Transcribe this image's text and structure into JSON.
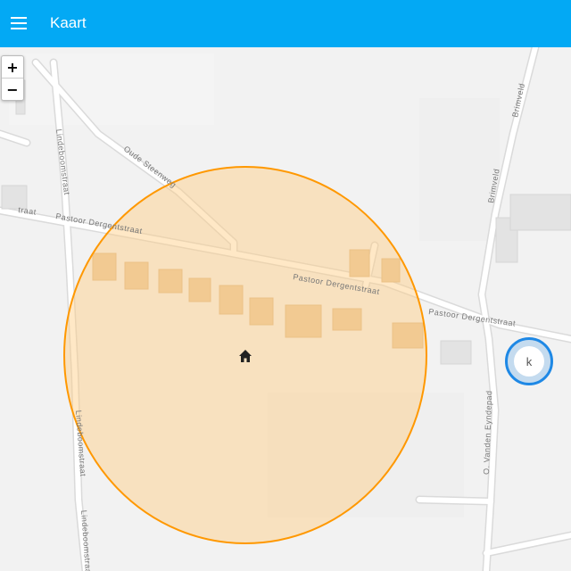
{
  "header": {
    "title": "Kaart",
    "menu_icon": "hamburger-menu-icon",
    "background_color": "#03a9f4"
  },
  "zoom": {
    "in_label": "+",
    "out_label": "−"
  },
  "streets": {
    "pastoor_left": "traat",
    "pastoor_1": "Pastoor Dergentstraat",
    "pastoor_2": "Pastoor Dergentstraat",
    "pastoor_3": "Pastoor Dergentstraat",
    "lindeboom_top": "Lindeboomstraat",
    "lindeboom_mid": "Lindeboomstraat",
    "lindeboom_bottom": "Lindeboomstraat",
    "oude_steenweg": "Oude Steenweg",
    "brimveld_top": "Brimveld",
    "brimveld_mid": "Brimveld",
    "vanden_eyndepad": "O. Vanden Eyndepad"
  },
  "home_zone": {
    "icon": "home-icon",
    "fill_color": "#ffcc80",
    "stroke_color": "#ff9800"
  },
  "person": {
    "initial": "k",
    "ring_color": "#1e88e5"
  }
}
